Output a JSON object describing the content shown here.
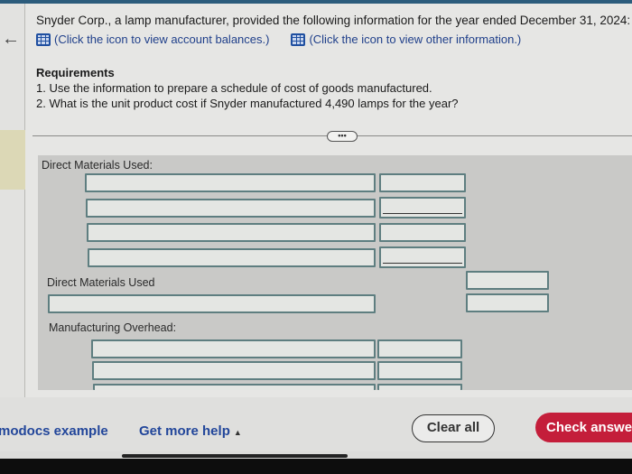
{
  "problem": {
    "intro": "Snyder Corp., a lamp manufacturer, provided the following information for the year ended December 31, 2024:",
    "links": [
      {
        "icon": "table-icon",
        "label": "(Click the icon to view account balances.)"
      },
      {
        "icon": "table-icon",
        "label": "(Click the icon to view other information.)"
      }
    ],
    "requirements_title": "Requirements",
    "requirements": [
      "1. Use the information to prepare a schedule of cost of goods manufactured.",
      "2. What is the unit product cost if Snyder manufactured 4,490 lamps for the year?"
    ],
    "more_button": "•••"
  },
  "form": {
    "direct_materials_heading": "Direct Materials Used:",
    "direct_materials_total_label": "Direct Materials Used",
    "manufacturing_overhead_heading": "Manufacturing Overhead:"
  },
  "footer": {
    "example_link": "modocs example",
    "help_link": "Get more help",
    "help_caret": "▲",
    "clear_button": "Clear all",
    "check_button": "Check answer"
  }
}
